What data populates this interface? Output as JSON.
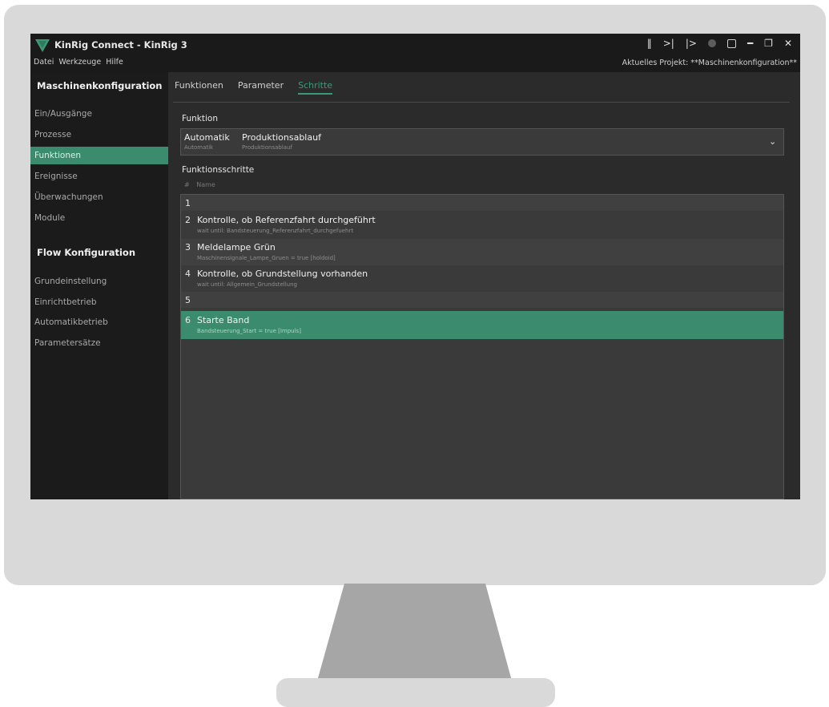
{
  "window": {
    "title": "KinRig Connect - KinRig 3",
    "menu": [
      "Datei",
      "Werkzeuge",
      "Hilfe"
    ],
    "project_label": "Aktuelles Projekt: **Maschinenkonfiguration**",
    "controls": [
      "pause-icon",
      "step-forward-icon",
      "play-icon",
      "record-icon",
      "stop-icon",
      "minimize-icon",
      "maximize-icon",
      "close-icon"
    ]
  },
  "sidebar": {
    "heading1": "Maschinenkonfiguration",
    "items1": [
      "Ein/Ausgänge",
      "Prozesse",
      "Funktionen",
      "Ereignisse",
      "Überwachungen",
      "Module"
    ],
    "heading2": "Flow Konfiguration",
    "items2": [
      "Grundeinstellung",
      "Einrichtbetrieb",
      "Automatikbetrieb",
      "Parametersätze"
    ]
  },
  "tabs": [
    "Funktionen",
    "Parameter",
    "Schritte"
  ],
  "funktion": {
    "label": "Funktion",
    "value_main": "Automatik",
    "value_main_sub": "Automatik",
    "value_name": "Produktionsablauf",
    "value_name_sub": "Produktionsablauf"
  },
  "steps": {
    "label": "Funktionsschritte",
    "col_number": "#",
    "col_name": "Name",
    "items": [
      {
        "num": "1",
        "title": "",
        "desc": ""
      },
      {
        "num": "2",
        "title": "Kontrolle, ob Referenzfahrt durchgeführt",
        "desc": "wait until: Bandsteuerung_Referenzfahrt_durchgefuehrt"
      },
      {
        "num": "3",
        "title": "Meldelampe Grün",
        "desc": "Maschinensignale_Lampe_Gruen = true [holdoid]"
      },
      {
        "num": "4",
        "title": "Kontrolle, ob Grundstellung vorhanden",
        "desc": "wait until: Allgemein_Grundstellung"
      },
      {
        "num": "5",
        "title": "",
        "desc": ""
      },
      {
        "num": "6",
        "title": "Starte Band",
        "desc": "Bandsteuerung_Start = true [Impuls]"
      }
    ]
  },
  "colors": {
    "accent": "#3b8c6e",
    "background": "#2b2b2b",
    "sidebar": "#1b1b1b"
  }
}
